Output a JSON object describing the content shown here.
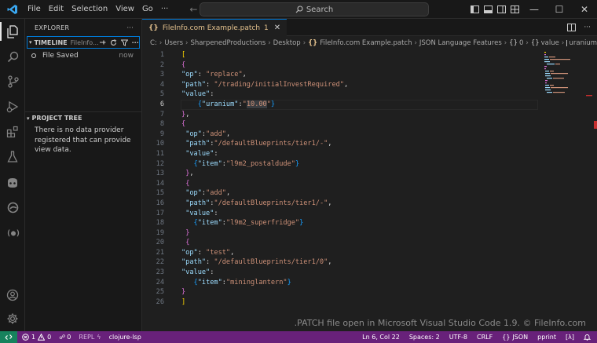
{
  "menu": [
    "File",
    "Edit",
    "Selection",
    "View",
    "Go",
    "···"
  ],
  "search": {
    "label": "Search"
  },
  "sidebar": {
    "title": "EXPLORER",
    "more": "···",
    "timeline": {
      "title": "TIMELINE",
      "file": "FileInfo...",
      "items": [
        {
          "label": "File Saved",
          "when": "now"
        }
      ]
    },
    "project_tree": {
      "title": "PROJECT TREE",
      "message": "There is no data provider registered that can provide view data."
    }
  },
  "editor": {
    "tab": {
      "icon": "{}",
      "name": "FileInfo.com Example.patch",
      "badge": "1"
    },
    "breadcrumb": {
      "path": [
        "C:",
        "Users",
        "SharpenedProductions",
        "Desktop"
      ],
      "file": "FileInfo.com Example.patch",
      "trail": [
        "JSON Language Features",
        "0",
        "value",
        "uranium"
      ]
    },
    "cursor_line": 6
  },
  "watermark": ".PATCH file open in Microsoft Visual Studio Code 1.9. © FileInfo.com",
  "statusbar": {
    "errors": "1",
    "warnings": "0",
    "ports": "0",
    "repl": "REPL",
    "lsp": "clojure-lsp",
    "position": "Ln 6, Col 22",
    "spaces": "Spaces: 2",
    "encoding": "UTF-8",
    "eol": "CRLF",
    "language": "JSON",
    "formatter": "pprint",
    "extra": "[λ]"
  },
  "colors": {
    "accent": "#0078d4",
    "statusbar": "#68217a",
    "remote": "#16825d",
    "filename": "#e2c08d"
  }
}
